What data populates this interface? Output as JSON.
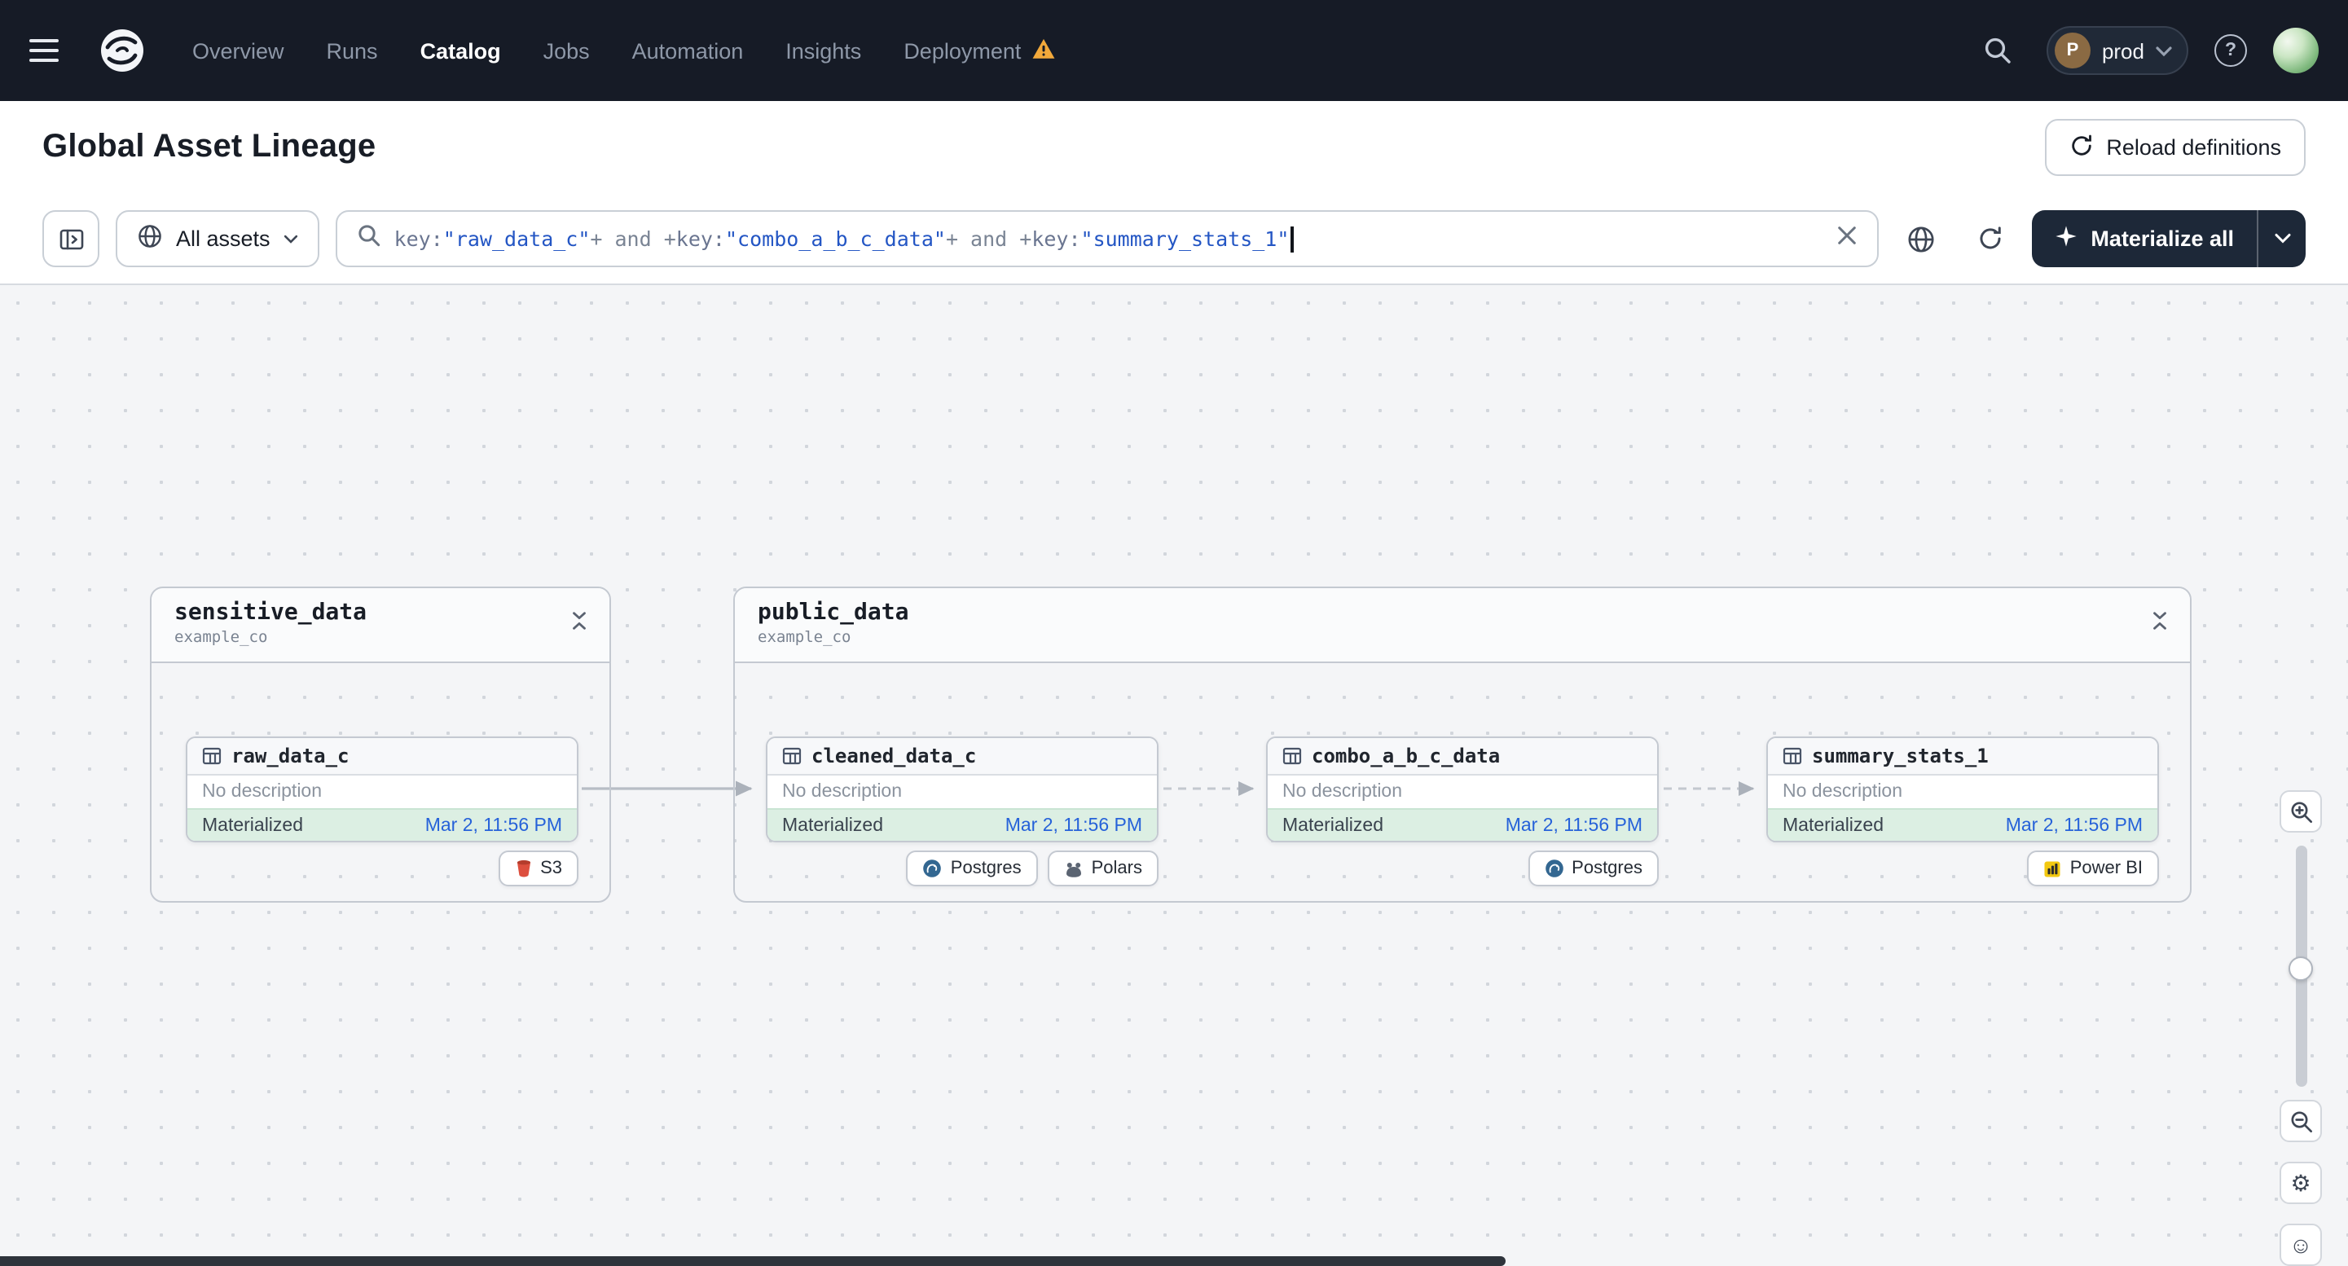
{
  "nav": {
    "items": [
      {
        "label": "Overview"
      },
      {
        "label": "Runs"
      },
      {
        "label": "Catalog"
      },
      {
        "label": "Jobs"
      },
      {
        "label": "Automation"
      },
      {
        "label": "Insights"
      },
      {
        "label": "Deployment"
      }
    ],
    "active_item": "Catalog",
    "deployment_switcher": {
      "avatar_letter": "P",
      "label": "prod"
    },
    "help_glyph": "?"
  },
  "header": {
    "title": "Global Asset Lineage",
    "reload_button_label": "Reload definitions"
  },
  "toolbar": {
    "scope_button_label": "All assets",
    "materialize_button_label": "Materialize all",
    "query": {
      "segments": [
        {
          "type": "key",
          "text": "key:"
        },
        {
          "type": "string",
          "text": "\"raw_data_c\""
        },
        {
          "type": "op",
          "text": "+ and +"
        },
        {
          "type": "key",
          "text": "key:"
        },
        {
          "type": "string",
          "text": "\"combo_a_b_c_data\""
        },
        {
          "type": "op",
          "text": "+ and +"
        },
        {
          "type": "key",
          "text": "key:"
        },
        {
          "type": "string",
          "text": "\"summary_stats_1\""
        }
      ]
    }
  },
  "graph": {
    "groups": [
      {
        "name": "sensitive_data",
        "subtitle": "example_co",
        "assets": [
          {
            "name": "raw_data_c",
            "description": "No description",
            "status": "Materialized",
            "timestamp": "Mar 2, 11:56 PM",
            "tags": [
              {
                "label": "S3"
              }
            ]
          }
        ]
      },
      {
        "name": "public_data",
        "subtitle": "example_co",
        "assets": [
          {
            "name": "cleaned_data_c",
            "description": "No description",
            "status": "Materialized",
            "timestamp": "Mar 2, 11:56 PM",
            "tags": [
              {
                "label": "Postgres"
              },
              {
                "label": "Polars"
              }
            ]
          },
          {
            "name": "combo_a_b_c_data",
            "description": "No description",
            "status": "Materialized",
            "timestamp": "Mar 2, 11:56 PM",
            "tags": [
              {
                "label": "Postgres"
              }
            ]
          },
          {
            "name": "summary_stats_1",
            "description": "No description",
            "status": "Materialized",
            "timestamp": "Mar 2, 11:56 PM",
            "tags": [
              {
                "label": "Power BI"
              }
            ]
          }
        ]
      }
    ]
  },
  "view_controls": {
    "settings_glyph": "⚙",
    "feedback_glyph": "☺"
  },
  "colors": {
    "nav_bg": "#161B26",
    "materialized_green_bg": "#DCEFE3",
    "timestamp_blue": "#2662D9",
    "warning_orange": "#F2A93B",
    "s3_red": "#DD4F3E",
    "postgres_blue": "#336791",
    "powerbi_yellow": "#F2C811",
    "query_string_blue": "#2456C4"
  }
}
